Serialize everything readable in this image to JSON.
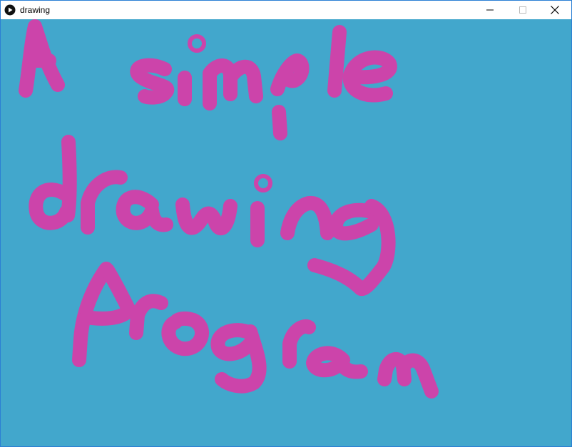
{
  "window": {
    "title": "drawing",
    "icon": "play-icon",
    "controls": {
      "minimize_icon": "minimize-icon",
      "maximize_icon": "maximize-icon",
      "close_icon": "close-icon"
    }
  },
  "canvas": {
    "background_color": "#42a7cc",
    "brush_color": "#cc44aa"
  },
  "colors": {
    "window_border": "#2b7fd4",
    "titlebar": "#ffffff"
  }
}
